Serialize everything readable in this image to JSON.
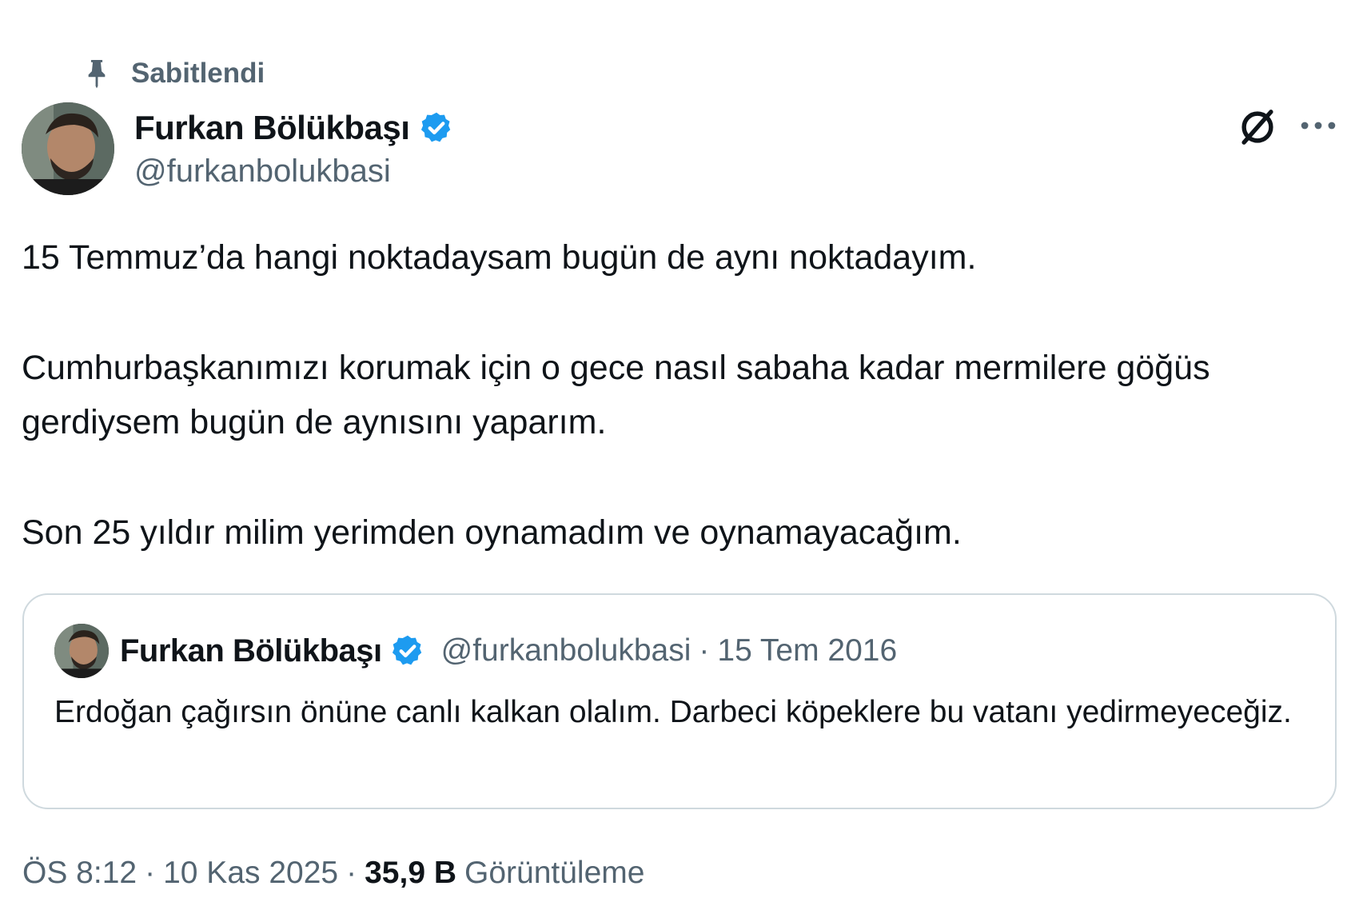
{
  "pinned": {
    "label": "Sabitlendi",
    "icon": "pin-icon"
  },
  "author": {
    "display_name": "Furkan Bölükbaşı",
    "handle": "@furkanbolukbasi",
    "verified_icon": "verified-badge-icon",
    "verified_color": "#1d9bf0"
  },
  "actions": {
    "grok_icon": "grok-icon",
    "more_icon": "more-options-icon"
  },
  "tweet": {
    "paragraphs": [
      "15 Temmuz’da hangi noktadaysam bugün de aynı noktadayım.",
      "Cumhurbaşkanımızı korumak için o gece nasıl sabaha kadar mermilere göğüs gerdiysem bugün de aynısını yaparım.",
      "Son 25 yıldır milim yerimden oynamadım ve oynamayacağım."
    ]
  },
  "quote": {
    "display_name": "Furkan Bölükbaşı",
    "handle": "@furkanbolukbasi",
    "separator": "·",
    "date": "15 Tem 2016",
    "text": "Erdoğan çağırsın önüne canlı kalkan olalım. Darbeci köpeklere bu vatanı yedirmeyeceğiz."
  },
  "meta": {
    "time": "ÖS 8:12",
    "separator": "·",
    "date": "10 Kas 2025",
    "views_count": "35,9 B",
    "views_label": "Görüntüleme"
  },
  "colors": {
    "text_primary": "#0f1419",
    "text_secondary": "#536471",
    "border": "#cfd9de",
    "accent": "#1d9bf0"
  }
}
